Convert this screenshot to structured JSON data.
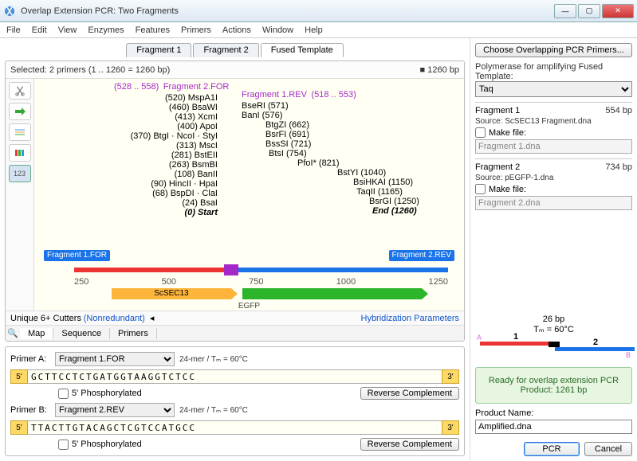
{
  "title": "Overlap Extension PCR: Two Fragments",
  "menu": [
    "File",
    "Edit",
    "View",
    "Enzymes",
    "Features",
    "Primers",
    "Actions",
    "Window",
    "Help"
  ],
  "tabs": {
    "items": [
      "Fragment 1",
      "Fragment 2",
      "Fused Template"
    ],
    "active": 2
  },
  "selection": "Selected:  2 primers (1 .. 1260  =  1260 bp)",
  "total_bp": "1260 bp",
  "overlap_label": "(528 .. 558)",
  "frag2for": "Fragment 2.FOR",
  "frag1rev_label": "Fragment 1.REV",
  "frag1rev_range": "(518 .. 553)",
  "sites_left": [
    "(520)  MspA1I",
    "(460)  BsaWI",
    "(413)  XcmI",
    "(400)  ApoI",
    "(370)  BtgI · NcoI · StyI",
    "(313)  MscI",
    "(281)  BstEII",
    "(263)  BsmBI",
    "(108)  BanII",
    "(90)  HincII · HpaI",
    "(68)  BspDI · ClaI",
    "(24)  BsaI",
    "(0)  Start"
  ],
  "sites_right": [
    "BseRI  (571)",
    "BanI  (576)",
    "BtgZI  (662)",
    "BsrFI  (691)",
    "BssSI  (721)",
    "BtsI  (754)",
    "PfoI*  (821)",
    "BstYI  (1040)",
    "BsiHKAI  (1150)",
    "TaqII  (1165)",
    "BsrGI  (1250)",
    "End  (1260)"
  ],
  "ticks": [
    "250",
    "500",
    "750",
    "1000",
    "1250"
  ],
  "genes": {
    "scsec13": "ScSEC13",
    "egfp": "EGFP"
  },
  "flags": {
    "for": "Fragment 1.FOR",
    "rev": "Fragment 2.REV"
  },
  "footer": {
    "unique": "Unique 6+ Cutters",
    "nonred": "(Nonredundant)",
    "hyb": "Hybridization Parameters"
  },
  "maptabs": [
    "Map",
    "Sequence",
    "Primers"
  ],
  "primerA": {
    "label": "Primer A:",
    "name": "Fragment 1.FOR",
    "info": "24-mer  /  Tₘ = 60°C",
    "seq": "GCTTCCTCTGATGGTAAGGTCTCC",
    "phos": "5' Phosphorylated",
    "rev": "Reverse Complement"
  },
  "primerB": {
    "label": "Primer B:",
    "name": "Fragment 2.REV",
    "info": "24-mer  /  Tₘ = 60°C",
    "seq": "TTACTTGTACAGCTCGTCCATGCC",
    "phos": "5' Phosphorylated",
    "rev": "Reverse Complement"
  },
  "right": {
    "choose": "Choose Overlapping PCR Primers...",
    "poly_label": "Polymerase for amplifying Fused Template:",
    "poly": "Taq",
    "frag1": {
      "name": "Fragment 1",
      "bp": "554 bp",
      "src": "Source:  ScSEC13 Fragment.dna",
      "make": "Make file:",
      "file": "Fragment 1.dna"
    },
    "frag2": {
      "name": "Fragment 2",
      "bp": "734 bp",
      "src": "Source:  pEGFP-1.dna",
      "make": "Make file:",
      "file": "Fragment 2.dna"
    },
    "diag": {
      "bp": "26 bp",
      "tm": "Tₘ = 60°C",
      "n1": "1",
      "n2": "2",
      "a": "A",
      "b": "B"
    },
    "status1": "Ready for overlap extension PCR",
    "status2": "Product:  1261 bp",
    "prodname_label": "Product Name:",
    "prodname": "Amplified.dna",
    "pcr": "PCR",
    "cancel": "Cancel"
  },
  "tools": {
    "num": "123"
  }
}
